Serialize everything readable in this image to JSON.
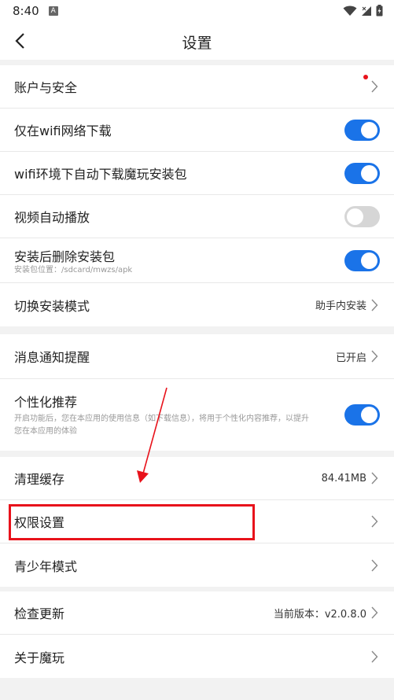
{
  "status_bar": {
    "time": "8:40",
    "app_icon_letter": "A",
    "icons": [
      "wifi-icon",
      "signal-icon",
      "battery-icon"
    ]
  },
  "header": {
    "title": "设置",
    "back_icon": "chevron-left-icon"
  },
  "groups": [
    {
      "rows": [
        {
          "title": "账户与安全",
          "control": "chevron",
          "badge": "red-dot"
        },
        {
          "title": "仅在wifi网络下载",
          "control": "toggle",
          "toggle_on": true
        },
        {
          "title": "wifi环境下自动下载魔玩安装包",
          "control": "toggle",
          "toggle_on": true
        },
        {
          "title": "视频自动播放",
          "control": "toggle",
          "toggle_on": false
        },
        {
          "title": "安装后删除安装包",
          "subtitle": "安装包位置：/sdcard/mwzs/apk",
          "control": "toggle",
          "toggle_on": true
        },
        {
          "title": "切换安装模式",
          "value": "助手内安装",
          "control": "chevron"
        }
      ]
    },
    {
      "rows": [
        {
          "title": "消息通知提醒",
          "value": "已开启",
          "control": "chevron"
        },
        {
          "title": "个性化推荐",
          "subtitle_line1": "开启功能后，您在本应用的使用信息（如下载信息），将用于个性化内容推荐，以提升",
          "subtitle_line2": "您在本应用的体验",
          "control": "toggle",
          "toggle_on": true
        }
      ]
    },
    {
      "rows": [
        {
          "title": "清理缓存",
          "value": "84.41MB",
          "control": "chevron"
        },
        {
          "title": "权限设置",
          "control": "chevron"
        },
        {
          "title": "青少年模式",
          "control": "chevron"
        }
      ]
    },
    {
      "rows": [
        {
          "title": "检查更新",
          "value": "当前版本：v2.0.8.0",
          "control": "chevron"
        },
        {
          "title": "关于魔玩",
          "control": "chevron"
        }
      ]
    }
  ],
  "colors": {
    "accent": "#1a73e8",
    "toggle_off": "#d6d6d6",
    "annotation_red": "#e8121b",
    "background": "#f2f2f2"
  }
}
